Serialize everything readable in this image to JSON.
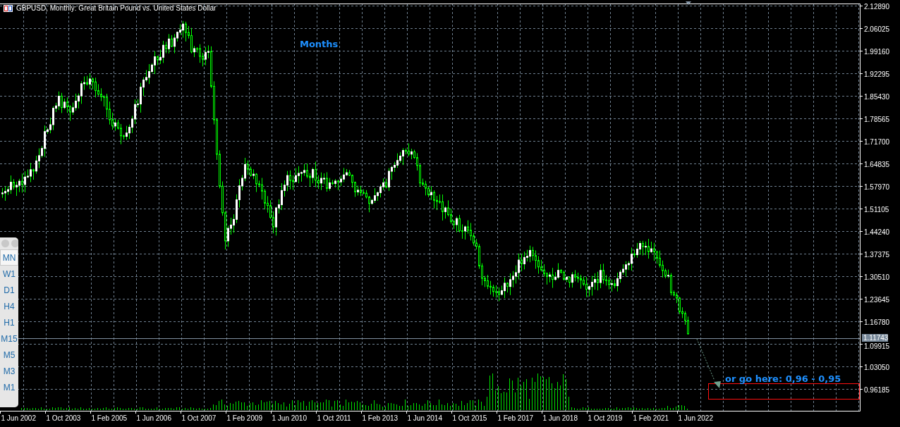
{
  "window": {
    "title": "GBPUSD, Monthly:  Great Britain Pound vs. United States Dollar"
  },
  "chart": {
    "period_label": "Months",
    "annotation": "or go here: 0,96 - 0,95",
    "current_price": "1.11743",
    "price_axis": [
      "2.12890",
      "2.06025",
      "1.99160",
      "1.92295",
      "1.85430",
      "1.78565",
      "1.71700",
      "1.64835",
      "1.57970",
      "1.51105",
      "1.44240",
      "1.37375",
      "1.30510",
      "1.23645",
      "1.16780",
      "1.09915",
      "1.03050",
      "0.96185"
    ],
    "time_axis": [
      "1 Jun 2002",
      "1 Oct 2003",
      "1 Feb 2005",
      "1 Jun 2006",
      "1 Oct 2007",
      "1 Feb 2009",
      "1 Jun 2010",
      "1 Oct 2011",
      "1 Feb 2013",
      "1 Jun 2014",
      "1 Oct 2015",
      "1 Feb 2017",
      "1 Jun 2018",
      "1 Oct 2019",
      "1 Feb 2021",
      "1 Jun 2022"
    ]
  },
  "timeframes": [
    {
      "label": "MN",
      "selected": true
    },
    {
      "label": "W1",
      "selected": false
    },
    {
      "label": "D1",
      "selected": false
    },
    {
      "label": "H4",
      "selected": false
    },
    {
      "label": "H1",
      "selected": false
    },
    {
      "label": "M15",
      "selected": false
    },
    {
      "label": "M5",
      "selected": false
    },
    {
      "label": "M3",
      "selected": false
    },
    {
      "label": "M1",
      "selected": false
    }
  ]
}
